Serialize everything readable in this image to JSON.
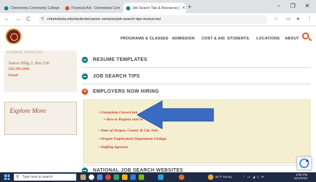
{
  "browser": {
    "tabs": [
      {
        "title": "Chemeketa Community College",
        "favicon_color": "#1b7e7f",
        "active": false
      },
      {
        "title": "Financial Aid - Chemeketa Com",
        "favicon_color": "#d4562b",
        "active": false
      },
      {
        "title": "Job Search Tips & Resources |",
        "favicon_color": "#1b7e7f",
        "active": true
      }
    ],
    "new_tab": "+",
    "controls": {
      "minimize": "−",
      "maximize": "❐",
      "close": "✕"
    },
    "nav": {
      "back": "←",
      "forward": "→",
      "reload": "C"
    },
    "url": "chemeketa.edu/students/career-services/job-search-tips-resources/"
  },
  "site": {
    "nav_items": [
      "PROGRAMS & CLASSES",
      "ADMISSION",
      "COST & AID",
      "STUDENTS",
      "LOCATIONS",
      "ABOUT"
    ]
  },
  "sidebar": {
    "faded_heading": "CAREER SERVICES",
    "address": "Salem Bldg 2, Rm 230",
    "phone": "503.399.5006",
    "email": "Email",
    "explore": "Explore More"
  },
  "accordion": [
    {
      "label": "RESUME TEMPLATES",
      "state": "collapsed"
    },
    {
      "label": "JOB SEARCH TIPS",
      "state": "collapsed"
    },
    {
      "label": "EMPLOYERS NOW HIRING",
      "state": "expanded"
    },
    {
      "label": "NATIONAL JOB SEARCH WEBSITES",
      "state": "collapsed"
    }
  ],
  "employers_links": [
    {
      "text": "Chemeketa CareerLink",
      "indent": false
    },
    {
      "text": "How to Register and Se",
      "indent": true
    },
    {
      "text": "State of Oregon, County & City Jobs",
      "indent": false
    },
    {
      "text": "Oregon Employment Department Listings",
      "indent": false
    },
    {
      "text": "Staffing Agencies",
      "indent": false
    }
  ],
  "taskbar": {
    "search_placeholder": "Type here to search",
    "weather": "61°F Sunny",
    "time": "3:05 PM",
    "date": "11/1/2023"
  },
  "colors": {
    "accent": "#d4562b",
    "teal": "#1b7e7f",
    "arrow": "#3a6bc4",
    "panel": "#f5efd2"
  }
}
